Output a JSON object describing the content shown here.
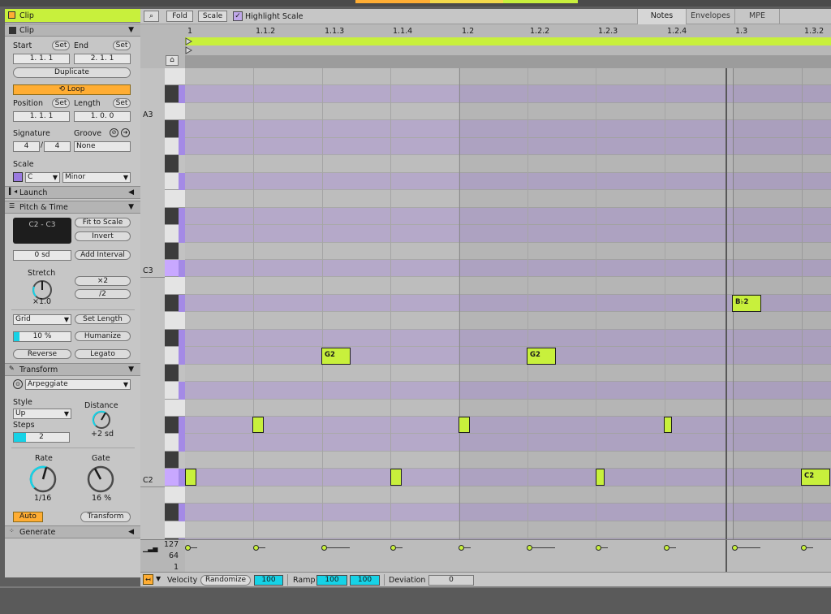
{
  "left_panel": {
    "clip_header": "Clip",
    "clip_section": "Clip",
    "start_label": "Start",
    "end_label": "End",
    "set_label": "Set",
    "start_value": "1.  1.  1",
    "end_value": "2.  1.  1",
    "duplicate": "Duplicate",
    "loop": "Loop",
    "position_label": "Position",
    "length_label": "Length",
    "position_value": "1.  1.  1",
    "length_value": "1.  0.  0",
    "signature_label": "Signature",
    "groove_label": "Groove",
    "sig_num": "4",
    "sig_den": "4",
    "groove_value": "None",
    "scale_label": "Scale",
    "scale_root": "C",
    "scale_mode": "Minor",
    "launch": "Launch",
    "pitch_time": "Pitch & Time",
    "range_display": "C2 - C3",
    "fit_to_scale": "Fit to Scale",
    "invert": "Invert",
    "transpose_value": "0 sd",
    "add_interval": "Add Interval",
    "stretch_label": "Stretch",
    "stretch_value": "×1.0",
    "x2": "×2",
    "div2": "/2",
    "grid_mode": "Grid",
    "set_length": "Set Length",
    "humanize_amount": "10 %",
    "humanize_fraction": 0.1,
    "humanize": "Humanize",
    "reverse": "Reverse",
    "legato": "Legato",
    "transform": "Transform",
    "arpeggiate": "Arpeggiate",
    "style_label": "Style",
    "style_value": "Up",
    "distance_label": "Distance",
    "distance_value": "+2 sd",
    "steps_label": "Steps",
    "steps_value": "2",
    "rate_label": "Rate",
    "rate_value": "1/16",
    "gate_label": "Gate",
    "gate_value": "16 %",
    "auto": "Auto",
    "transform_button": "Transform",
    "generate": "Generate"
  },
  "toolbar": {
    "fold": "Fold",
    "scale": "Scale",
    "highlight_scale": "Highlight Scale",
    "tab_notes": "Notes",
    "tab_envelopes": "Envelopes",
    "tab_mpe": "MPE"
  },
  "ruler_labels": [
    "1",
    "1.1.2",
    "1.1.3",
    "1.1.4",
    "1.2",
    "1.2.2",
    "1.2.3",
    "1.2.4",
    "1.3",
    "1.3.2"
  ],
  "key_labels": {
    "a3": "A3",
    "c3": "C3",
    "c2": "C2"
  },
  "notes_labeled": {
    "g2a": "G2",
    "g2b": "G2",
    "bb2": "B♭2",
    "c2": "C2"
  },
  "velocity": {
    "v127": "127",
    "v64": "64",
    "v1": "1"
  },
  "bottom_bar": {
    "velocity_label": "Velocity",
    "randomize": "Randomize",
    "velocity_value": "100",
    "ramp_label": "Ramp",
    "ramp_start": "100",
    "ramp_end": "100",
    "deviation_label": "Deviation",
    "deviation_value": "0"
  },
  "colors": {
    "accent_green": "#c8f03c",
    "loop_orange": "#ffad33",
    "scale_lane": "#b5a9c9",
    "knob_cyan": "#16d2e6"
  }
}
